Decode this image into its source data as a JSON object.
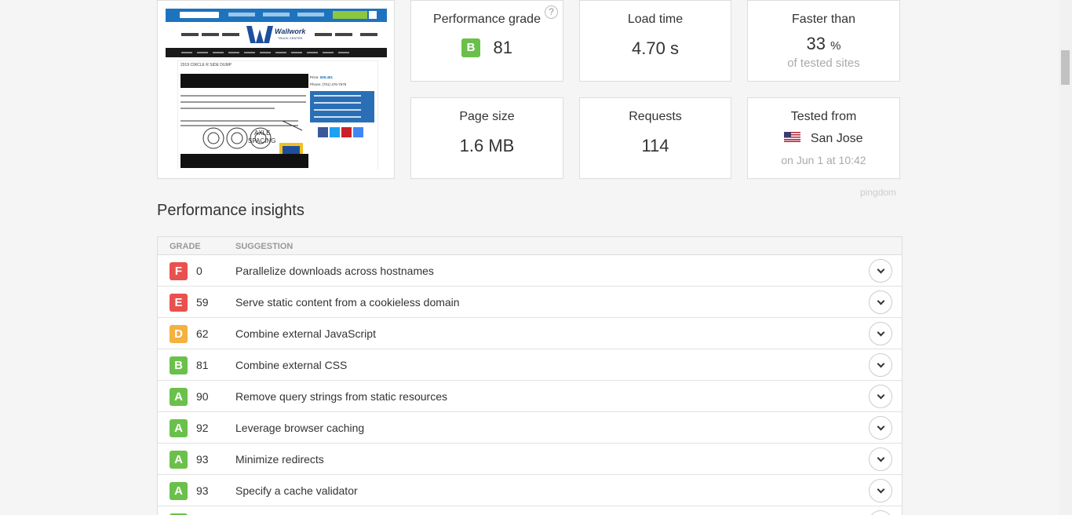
{
  "colors": {
    "grade_A": "#6bc04b",
    "grade_B": "#6bc04b",
    "grade_D": "#f4b13e",
    "grade_E": "#e9514f",
    "grade_F": "#e9514f"
  },
  "thumbnail": {
    "site_name": "Wallwork",
    "site_tagline": "TRUCK CENTER",
    "page_title": "2019 CIRCLE R SIDE DUMP",
    "price_label": "Price:",
    "price_value": "$59,481",
    "phone_label": "Phone:",
    "phone_value": "(701) 476-7675"
  },
  "stats": {
    "performance_grade": {
      "label": "Performance grade",
      "grade": "B",
      "score": "81",
      "help": "?"
    },
    "load_time": {
      "label": "Load time",
      "value": "4.70 s"
    },
    "faster_than": {
      "label": "Faster than",
      "value": "33",
      "unit": "%",
      "sub": "of tested sites"
    },
    "page_size": {
      "label": "Page size",
      "value": "1.6 MB"
    },
    "requests": {
      "label": "Requests",
      "value": "114"
    },
    "tested_from": {
      "label": "Tested from",
      "location": "San Jose",
      "sub": "on Jun 1 at 10:42",
      "flag": "us-flag-icon"
    }
  },
  "brand": "pingdom",
  "insights": {
    "title": "Performance insights",
    "columns": [
      "GRADE",
      "SUGGESTION"
    ],
    "rows": [
      {
        "grade": "F",
        "score": "0",
        "suggestion": "Parallelize downloads across hostnames"
      },
      {
        "grade": "E",
        "score": "59",
        "suggestion": "Serve static content from a cookieless domain"
      },
      {
        "grade": "D",
        "score": "62",
        "suggestion": "Combine external JavaScript"
      },
      {
        "grade": "B",
        "score": "81",
        "suggestion": "Combine external CSS"
      },
      {
        "grade": "A",
        "score": "90",
        "suggestion": "Remove query strings from static resources"
      },
      {
        "grade": "A",
        "score": "92",
        "suggestion": "Leverage browser caching"
      },
      {
        "grade": "A",
        "score": "93",
        "suggestion": "Minimize redirects"
      },
      {
        "grade": "A",
        "score": "93",
        "suggestion": "Specify a cache validator"
      },
      {
        "grade": "A",
        "score": "",
        "suggestion": ""
      }
    ]
  }
}
